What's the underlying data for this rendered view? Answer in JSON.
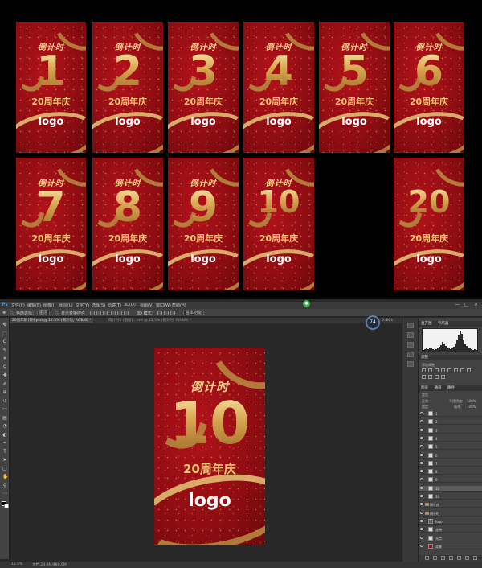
{
  "posters": [
    {
      "number": "1",
      "title": "倒计时",
      "subtitle": "20周年庆",
      "logo": "logo"
    },
    {
      "number": "2",
      "title": "倒计时",
      "subtitle": "20周年庆",
      "logo": "logo"
    },
    {
      "number": "3",
      "title": "倒计时",
      "subtitle": "20周年庆",
      "logo": "logo"
    },
    {
      "number": "4",
      "title": "倒计时",
      "subtitle": "20周年庆",
      "logo": "logo"
    },
    {
      "number": "5",
      "title": "倒计时",
      "subtitle": "20周年庆",
      "logo": "logo"
    },
    {
      "number": "6",
      "title": "倒计时",
      "subtitle": "20周年庆",
      "logo": "logo"
    },
    {
      "number": "7",
      "title": "倒计时",
      "subtitle": "20周年庆",
      "logo": "logo"
    },
    {
      "number": "8",
      "title": "倒计时",
      "subtitle": "20周年庆",
      "logo": "logo"
    },
    {
      "number": "9",
      "title": "倒计时",
      "subtitle": "20周年庆",
      "logo": "logo"
    },
    {
      "number": "10",
      "title": "倒计时",
      "subtitle": "20周年庆",
      "logo": "logo"
    },
    {
      "number": "20",
      "title": "",
      "subtitle": "20周年庆",
      "logo": "logo"
    }
  ],
  "photoshop": {
    "app_logo": "Ps",
    "menu": [
      "文件(F)",
      "编辑(E)",
      "图像(I)",
      "图层(L)",
      "文字(Y)",
      "选择(S)",
      "滤镜(T)",
      "3D(D)",
      "视图(V)",
      "窗口(W)",
      "帮助(H)"
    ],
    "notification": "●",
    "options": {
      "auto_select_label": "自动选择：",
      "auto_select_value": "图层",
      "transform_label": "显示变换控件",
      "mode_label": "3D 模式：",
      "workspace": "基本功能"
    },
    "tabs": [
      {
        "label": "20周年倒计时.psd @ 12.5% (倒计时, RGB/8) *",
        "active": true
      },
      {
        "label": "倒计时2 (图层)...psd @ 12.5% (倒计时, RGB/8) *",
        "active": false
      }
    ],
    "zoom_badge": "74",
    "zoom_text": "0.4K/s",
    "status_zoom": "12.5%",
    "status_doc": "文档:24.0M/480.0M",
    "main_poster": {
      "number": "10",
      "title": "倒计时",
      "subtitle": "20周年庆",
      "logo": "logo"
    },
    "panels": {
      "histogram_tab": "直方图",
      "navigator_tab": "导航器",
      "adjust_tab": "调整",
      "add_adjust": "添加调整",
      "layers_tab": "图层",
      "channels_tab": "通道",
      "paths_tab": "路径",
      "kind_filter": "类型",
      "blend_mode": "正常",
      "opacity_label": "不透明度:",
      "opacity_value": "100%",
      "lock_label": "锁定:",
      "fill_label": "填充:",
      "fill_value": "100%",
      "layers": [
        {
          "name": "1",
          "type": "layer"
        },
        {
          "name": "2",
          "type": "layer"
        },
        {
          "name": "3",
          "type": "layer"
        },
        {
          "name": "4",
          "type": "layer"
        },
        {
          "name": "5",
          "type": "layer"
        },
        {
          "name": "6",
          "type": "layer"
        },
        {
          "name": "7",
          "type": "layer"
        },
        {
          "name": "8",
          "type": "layer"
        },
        {
          "name": "9",
          "type": "layer"
        },
        {
          "name": "10",
          "type": "layer"
        },
        {
          "name": "20",
          "type": "layer"
        },
        {
          "name": "周年庆",
          "type": "group"
        },
        {
          "name": "倒计时",
          "type": "group"
        },
        {
          "name": "logo",
          "type": "text"
        },
        {
          "name": "丝带",
          "type": "layer"
        },
        {
          "name": "光点",
          "type": "layer"
        },
        {
          "name": "背景",
          "type": "fill"
        }
      ]
    }
  }
}
